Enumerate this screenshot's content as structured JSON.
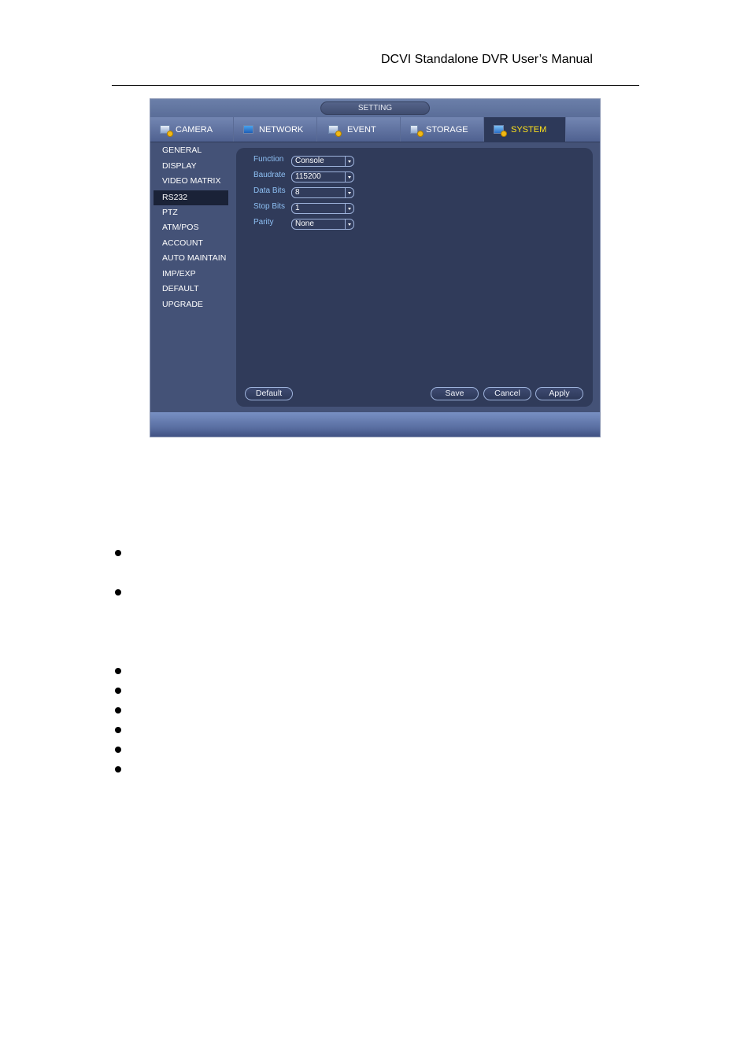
{
  "document": {
    "header_title": "DCVI Standalone DVR User’s Manual"
  },
  "dvr_window": {
    "title": "SETTING",
    "tabs": [
      {
        "label": "CAMERA",
        "icon": "camera-gear-icon",
        "active": false
      },
      {
        "label": "NETWORK",
        "icon": "network-icon",
        "active": false
      },
      {
        "label": "EVENT",
        "icon": "event-gear-icon",
        "active": false
      },
      {
        "label": "STORAGE",
        "icon": "storage-gear-icon",
        "active": false
      },
      {
        "label": "SYSTEM",
        "icon": "system-gear-icon",
        "active": true
      }
    ],
    "sidebar": {
      "items": [
        {
          "label": "GENERAL",
          "active": false
        },
        {
          "label": "DISPLAY",
          "active": false
        },
        {
          "label": "VIDEO MATRIX",
          "active": false
        },
        {
          "label": "RS232",
          "active": true
        },
        {
          "label": "PTZ",
          "active": false
        },
        {
          "label": "ATM/POS",
          "active": false
        },
        {
          "label": "ACCOUNT",
          "active": false
        },
        {
          "label": "AUTO MAINTAIN",
          "active": false
        },
        {
          "label": "IMP/EXP",
          "active": false
        },
        {
          "label": "DEFAULT",
          "active": false
        },
        {
          "label": "UPGRADE",
          "active": false
        }
      ]
    },
    "form": {
      "fields": [
        {
          "label": "Function",
          "value": "Console"
        },
        {
          "label": "Baudrate",
          "value": "115200"
        },
        {
          "label": "Data Bits",
          "value": "8"
        },
        {
          "label": "Stop Bits",
          "value": "1"
        },
        {
          "label": "Parity",
          "value": "None"
        }
      ]
    },
    "buttons": {
      "default": "Default",
      "save": "Save",
      "cancel": "Cancel",
      "apply": "Apply"
    },
    "colors": {
      "active_tab_text": "#ffe21b",
      "field_label": "#8ec0f4",
      "panel_bg": "#303b5a",
      "window_bg": "#445277"
    }
  },
  "bullet_list": {
    "count": 8
  }
}
